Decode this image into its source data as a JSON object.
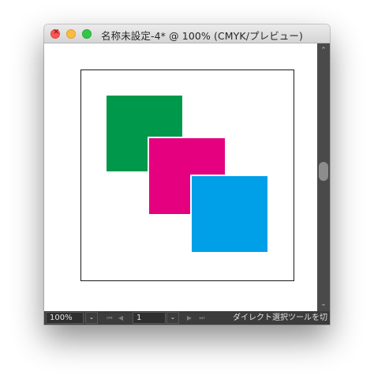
{
  "window": {
    "title": "名称未設定-4* @ 100% (CMYK/プレビュー)",
    "close_glyph": "×"
  },
  "artwork": {
    "squares": [
      {
        "name": "green-square",
        "color": "#00984a"
      },
      {
        "name": "magenta-square",
        "color": "#e4007f"
      },
      {
        "name": "cyan-square",
        "color": "#00a0e9"
      }
    ]
  },
  "scrollbar": {
    "up_glyph": "⌃",
    "down_glyph": "⌄"
  },
  "statusbar": {
    "zoom_value": "100%",
    "dropdown_glyph": "⌄",
    "first_glyph": "⏮",
    "prev_glyph": "◀",
    "page_value": "1",
    "next_glyph": "▶",
    "last_glyph": "⏭",
    "status_text": "ダイレクト選択ツールを切"
  }
}
